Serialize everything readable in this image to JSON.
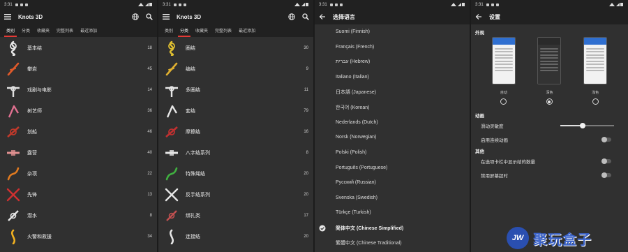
{
  "status": {
    "time": "3:31"
  },
  "app": {
    "title": "Knots 3D",
    "tabs": [
      "类别",
      "分类",
      "收藏夹",
      "完整列表",
      "最近添加"
    ]
  },
  "screen1": {
    "active_tab": 0,
    "rows": [
      {
        "label": "基本结",
        "count": "18",
        "color": "#e6e6e6"
      },
      {
        "label": "攀岩",
        "count": "45",
        "color": "#e05a2a"
      },
      {
        "label": "戏剧与电影",
        "count": "14",
        "color": "#e0e0e0"
      },
      {
        "label": "树艺师",
        "count": "36",
        "color": "#e07090"
      },
      {
        "label": "划船",
        "count": "46",
        "color": "#c0392b"
      },
      {
        "label": "露营",
        "count": "40",
        "color": "#e09090"
      },
      {
        "label": "杂项",
        "count": "22",
        "color": "#e07a20"
      },
      {
        "label": "先锋",
        "count": "13",
        "color": "#d03030"
      },
      {
        "label": "潜水",
        "count": "8",
        "color": "#e6e6e6"
      },
      {
        "label": "火警和救援",
        "count": "34",
        "color": "#f0b020"
      }
    ]
  },
  "screen2": {
    "active_tab": 1,
    "rows": [
      {
        "label": "圈结",
        "count": "30",
        "color": "#e0c030"
      },
      {
        "label": "编结",
        "count": "9",
        "color": "#e0b030"
      },
      {
        "label": "多圈结",
        "count": "11",
        "color": "#e6e6e6"
      },
      {
        "label": "套结",
        "count": "79",
        "color": "#e6e6e6"
      },
      {
        "label": "摩擦结",
        "count": "16",
        "color": "#c03030"
      },
      {
        "label": "八字结系列",
        "count": "8",
        "color": "#e6e6e6"
      },
      {
        "label": "特殊绳结",
        "count": "20",
        "color": "#40b040"
      },
      {
        "label": "反手结系列",
        "count": "20",
        "color": "#e6e6e6"
      },
      {
        "label": "绑扎类",
        "count": "17",
        "color": "#c05050"
      },
      {
        "label": "连接结",
        "count": "20",
        "color": "#e6e6e6"
      }
    ]
  },
  "screen3": {
    "title": "选择语言",
    "languages": [
      "Suomi (Finnish)",
      "Français (French)",
      "עברית (Hebrew)",
      "Italiano (Italian)",
      "日本語 (Japanese)",
      "한국어 (Korean)",
      "Nederlands (Dutch)",
      "Norsk (Norwegian)",
      "Polski (Polish)",
      "Português (Portuguese)",
      "Русский (Russian)",
      "Svenska (Swedish)",
      "Türkçe (Turkish)",
      "简体中文 (Chinese Simplified)",
      "繁體中文 (Chinese Traditional)"
    ],
    "selected_index": 13
  },
  "screen4": {
    "title": "设置",
    "appearance_section": "外观",
    "themes": [
      {
        "label": "自动",
        "selected": false
      },
      {
        "label": "深色",
        "selected": true
      },
      {
        "label": "浅色",
        "selected": false
      }
    ],
    "animation_section": "动画",
    "slide_sensitivity_label": "滑动灵敏度",
    "slide_sensitivity_value": 0.42,
    "continuous_animation_label": "启用连续动画",
    "other_section": "其他",
    "show_count_label": "在选项卡栏中显示结的数量",
    "disable_timeout_label": "禁用屏幕超时"
  },
  "watermark": {
    "badge": "JW",
    "text": "聚玩盒子"
  }
}
